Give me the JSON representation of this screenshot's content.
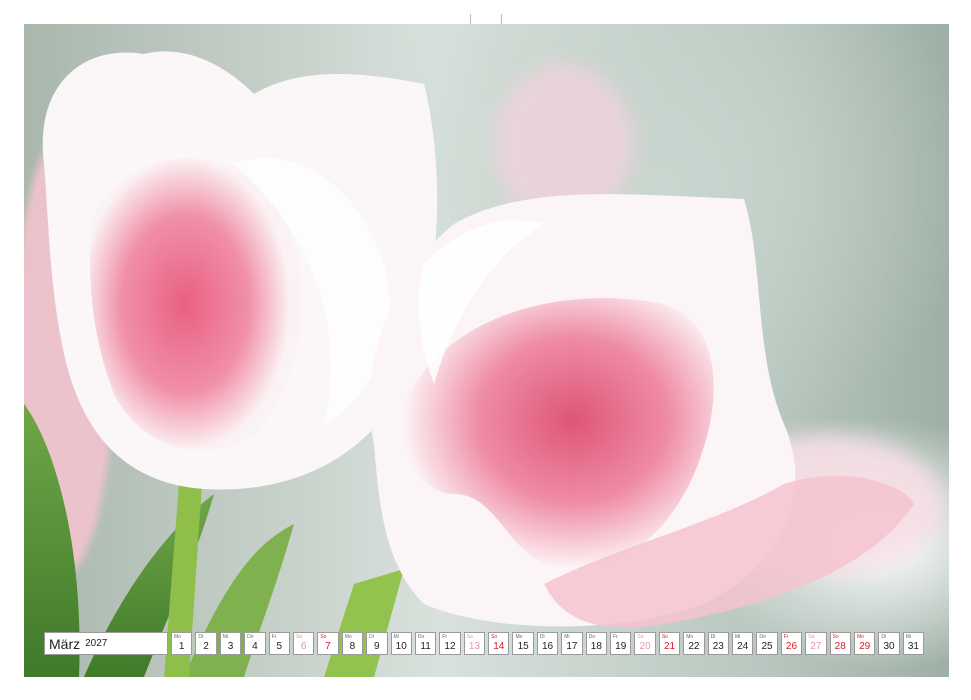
{
  "calendar": {
    "month": "März",
    "year": "2027",
    "days": [
      {
        "wd": "Mo",
        "n": "1",
        "t": ""
      },
      {
        "wd": "Di",
        "n": "2",
        "t": ""
      },
      {
        "wd": "Mi",
        "n": "3",
        "t": ""
      },
      {
        "wd": "Do",
        "n": "4",
        "t": ""
      },
      {
        "wd": "Fr",
        "n": "5",
        "t": ""
      },
      {
        "wd": "Sa",
        "n": "6",
        "t": "sat"
      },
      {
        "wd": "So",
        "n": "7",
        "t": "sun"
      },
      {
        "wd": "Mo",
        "n": "8",
        "t": ""
      },
      {
        "wd": "Di",
        "n": "9",
        "t": ""
      },
      {
        "wd": "Mi",
        "n": "10",
        "t": ""
      },
      {
        "wd": "Do",
        "n": "11",
        "t": ""
      },
      {
        "wd": "Fr",
        "n": "12",
        "t": ""
      },
      {
        "wd": "Sa",
        "n": "13",
        "t": "sat"
      },
      {
        "wd": "So",
        "n": "14",
        "t": "sun"
      },
      {
        "wd": "Mo",
        "n": "15",
        "t": ""
      },
      {
        "wd": "Di",
        "n": "16",
        "t": ""
      },
      {
        "wd": "Mi",
        "n": "17",
        "t": ""
      },
      {
        "wd": "Do",
        "n": "18",
        "t": ""
      },
      {
        "wd": "Fr",
        "n": "19",
        "t": ""
      },
      {
        "wd": "Sa",
        "n": "20",
        "t": "sat"
      },
      {
        "wd": "So",
        "n": "21",
        "t": "sun"
      },
      {
        "wd": "Mo",
        "n": "22",
        "t": ""
      },
      {
        "wd": "Di",
        "n": "23",
        "t": ""
      },
      {
        "wd": "Mi",
        "n": "24",
        "t": ""
      },
      {
        "wd": "Do",
        "n": "25",
        "t": ""
      },
      {
        "wd": "Fr",
        "n": "26",
        "t": "sun"
      },
      {
        "wd": "Sa",
        "n": "27",
        "t": "sat"
      },
      {
        "wd": "So",
        "n": "28",
        "t": "sun"
      },
      {
        "wd": "Mo",
        "n": "29",
        "t": "sun"
      },
      {
        "wd": "Di",
        "n": "30",
        "t": ""
      },
      {
        "wd": "Mi",
        "n": "31",
        "t": ""
      }
    ]
  },
  "photo": {
    "subject": "tulip-photo",
    "colors": {
      "petal_white": "#fbf7f8",
      "petal_pink": "#e35c7c",
      "stem_green": "#8fbf4a",
      "leaf_green": "#5f9a3a"
    }
  }
}
